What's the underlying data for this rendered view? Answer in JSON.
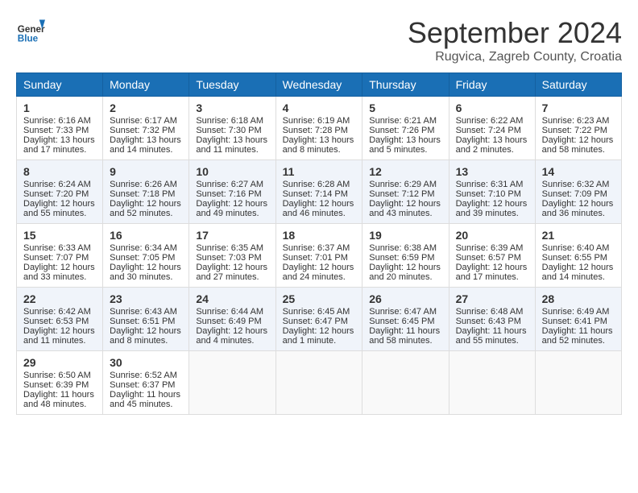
{
  "header": {
    "logo_general": "General",
    "logo_blue": "Blue",
    "month_title": "September 2024",
    "location": "Rugvica, Zagreb County, Croatia"
  },
  "weekdays": [
    "Sunday",
    "Monday",
    "Tuesday",
    "Wednesday",
    "Thursday",
    "Friday",
    "Saturday"
  ],
  "weeks": [
    [
      {
        "day": "1",
        "sunrise": "Sunrise: 6:16 AM",
        "sunset": "Sunset: 7:33 PM",
        "daylight": "Daylight: 13 hours and 17 minutes."
      },
      {
        "day": "2",
        "sunrise": "Sunrise: 6:17 AM",
        "sunset": "Sunset: 7:32 PM",
        "daylight": "Daylight: 13 hours and 14 minutes."
      },
      {
        "day": "3",
        "sunrise": "Sunrise: 6:18 AM",
        "sunset": "Sunset: 7:30 PM",
        "daylight": "Daylight: 13 hours and 11 minutes."
      },
      {
        "day": "4",
        "sunrise": "Sunrise: 6:19 AM",
        "sunset": "Sunset: 7:28 PM",
        "daylight": "Daylight: 13 hours and 8 minutes."
      },
      {
        "day": "5",
        "sunrise": "Sunrise: 6:21 AM",
        "sunset": "Sunset: 7:26 PM",
        "daylight": "Daylight: 13 hours and 5 minutes."
      },
      {
        "day": "6",
        "sunrise": "Sunrise: 6:22 AM",
        "sunset": "Sunset: 7:24 PM",
        "daylight": "Daylight: 13 hours and 2 minutes."
      },
      {
        "day": "7",
        "sunrise": "Sunrise: 6:23 AM",
        "sunset": "Sunset: 7:22 PM",
        "daylight": "Daylight: 12 hours and 58 minutes."
      }
    ],
    [
      {
        "day": "8",
        "sunrise": "Sunrise: 6:24 AM",
        "sunset": "Sunset: 7:20 PM",
        "daylight": "Daylight: 12 hours and 55 minutes."
      },
      {
        "day": "9",
        "sunrise": "Sunrise: 6:26 AM",
        "sunset": "Sunset: 7:18 PM",
        "daylight": "Daylight: 12 hours and 52 minutes."
      },
      {
        "day": "10",
        "sunrise": "Sunrise: 6:27 AM",
        "sunset": "Sunset: 7:16 PM",
        "daylight": "Daylight: 12 hours and 49 minutes."
      },
      {
        "day": "11",
        "sunrise": "Sunrise: 6:28 AM",
        "sunset": "Sunset: 7:14 PM",
        "daylight": "Daylight: 12 hours and 46 minutes."
      },
      {
        "day": "12",
        "sunrise": "Sunrise: 6:29 AM",
        "sunset": "Sunset: 7:12 PM",
        "daylight": "Daylight: 12 hours and 43 minutes."
      },
      {
        "day": "13",
        "sunrise": "Sunrise: 6:31 AM",
        "sunset": "Sunset: 7:10 PM",
        "daylight": "Daylight: 12 hours and 39 minutes."
      },
      {
        "day": "14",
        "sunrise": "Sunrise: 6:32 AM",
        "sunset": "Sunset: 7:09 PM",
        "daylight": "Daylight: 12 hours and 36 minutes."
      }
    ],
    [
      {
        "day": "15",
        "sunrise": "Sunrise: 6:33 AM",
        "sunset": "Sunset: 7:07 PM",
        "daylight": "Daylight: 12 hours and 33 minutes."
      },
      {
        "day": "16",
        "sunrise": "Sunrise: 6:34 AM",
        "sunset": "Sunset: 7:05 PM",
        "daylight": "Daylight: 12 hours and 30 minutes."
      },
      {
        "day": "17",
        "sunrise": "Sunrise: 6:35 AM",
        "sunset": "Sunset: 7:03 PM",
        "daylight": "Daylight: 12 hours and 27 minutes."
      },
      {
        "day": "18",
        "sunrise": "Sunrise: 6:37 AM",
        "sunset": "Sunset: 7:01 PM",
        "daylight": "Daylight: 12 hours and 24 minutes."
      },
      {
        "day": "19",
        "sunrise": "Sunrise: 6:38 AM",
        "sunset": "Sunset: 6:59 PM",
        "daylight": "Daylight: 12 hours and 20 minutes."
      },
      {
        "day": "20",
        "sunrise": "Sunrise: 6:39 AM",
        "sunset": "Sunset: 6:57 PM",
        "daylight": "Daylight: 12 hours and 17 minutes."
      },
      {
        "day": "21",
        "sunrise": "Sunrise: 6:40 AM",
        "sunset": "Sunset: 6:55 PM",
        "daylight": "Daylight: 12 hours and 14 minutes."
      }
    ],
    [
      {
        "day": "22",
        "sunrise": "Sunrise: 6:42 AM",
        "sunset": "Sunset: 6:53 PM",
        "daylight": "Daylight: 12 hours and 11 minutes."
      },
      {
        "day": "23",
        "sunrise": "Sunrise: 6:43 AM",
        "sunset": "Sunset: 6:51 PM",
        "daylight": "Daylight: 12 hours and 8 minutes."
      },
      {
        "day": "24",
        "sunrise": "Sunrise: 6:44 AM",
        "sunset": "Sunset: 6:49 PM",
        "daylight": "Daylight: 12 hours and 4 minutes."
      },
      {
        "day": "25",
        "sunrise": "Sunrise: 6:45 AM",
        "sunset": "Sunset: 6:47 PM",
        "daylight": "Daylight: 12 hours and 1 minute."
      },
      {
        "day": "26",
        "sunrise": "Sunrise: 6:47 AM",
        "sunset": "Sunset: 6:45 PM",
        "daylight": "Daylight: 11 hours and 58 minutes."
      },
      {
        "day": "27",
        "sunrise": "Sunrise: 6:48 AM",
        "sunset": "Sunset: 6:43 PM",
        "daylight": "Daylight: 11 hours and 55 minutes."
      },
      {
        "day": "28",
        "sunrise": "Sunrise: 6:49 AM",
        "sunset": "Sunset: 6:41 PM",
        "daylight": "Daylight: 11 hours and 52 minutes."
      }
    ],
    [
      {
        "day": "29",
        "sunrise": "Sunrise: 6:50 AM",
        "sunset": "Sunset: 6:39 PM",
        "daylight": "Daylight: 11 hours and 48 minutes."
      },
      {
        "day": "30",
        "sunrise": "Sunrise: 6:52 AM",
        "sunset": "Sunset: 6:37 PM",
        "daylight": "Daylight: 11 hours and 45 minutes."
      },
      null,
      null,
      null,
      null,
      null
    ]
  ]
}
